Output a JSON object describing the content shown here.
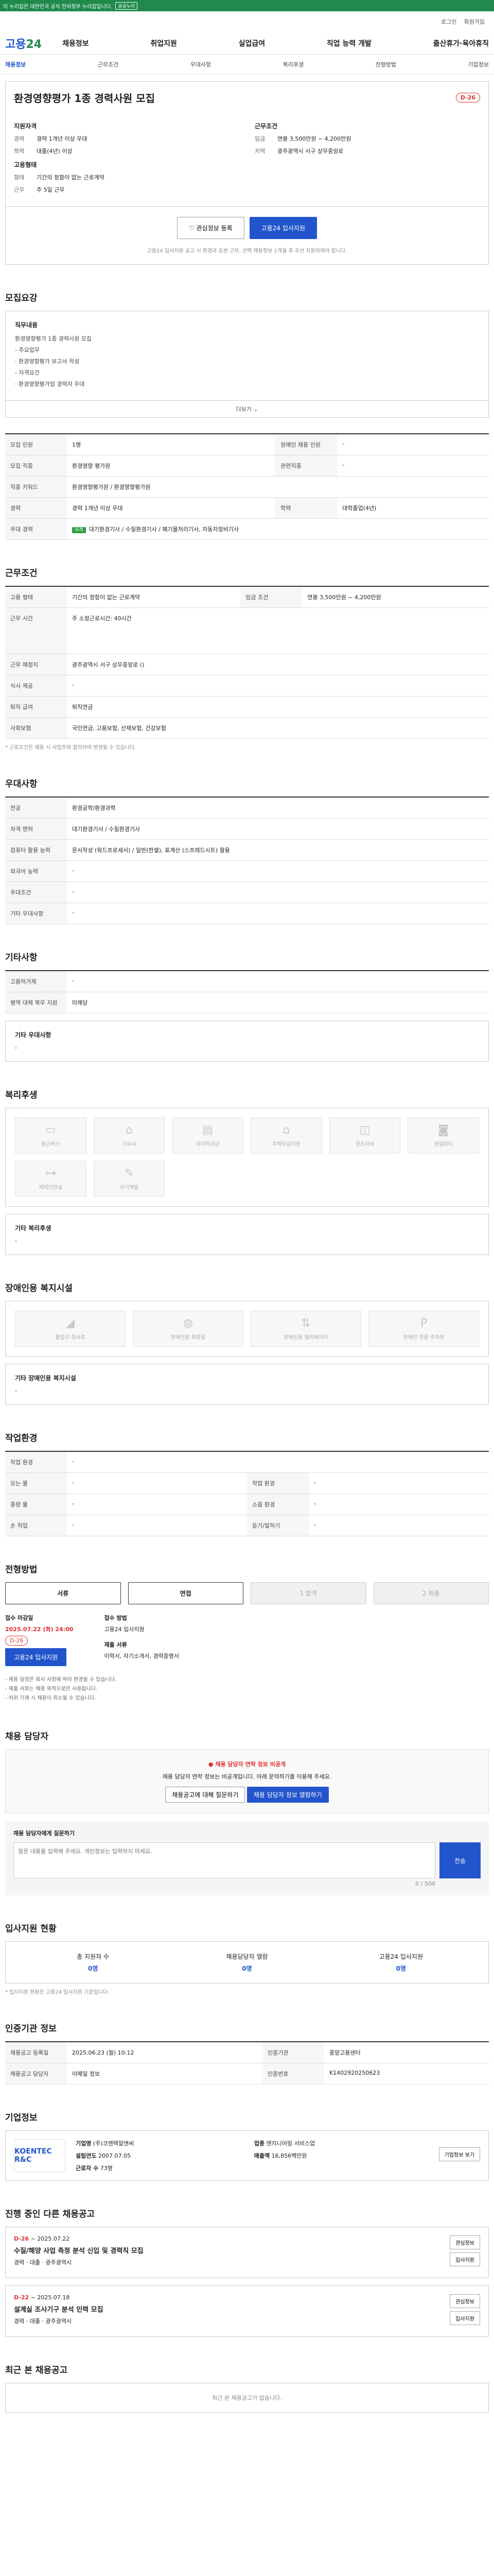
{
  "topbar": {
    "text": "이 누리집은 대한민국 공식 전자정부 누리집입니다.",
    "btn": "공공누리"
  },
  "util": [
    "로그인",
    "회원가입"
  ],
  "logo": {
    "a": "고용",
    "b": "24"
  },
  "gnb": [
    "채용정보",
    "취업지원",
    "실업급여",
    "직업 능력 개발",
    "출산휴가·육아휴직"
  ],
  "tabs": [
    "채용정보",
    "근무조건",
    "우대사항",
    "복리후생",
    "전형방법",
    "기업정보"
  ],
  "job": {
    "title": "환경영향평가 1종 경력사원 모집",
    "dday": "D-26",
    "left_title": "지원자격",
    "left": [
      {
        "k": "경력",
        "v": "경력 1개년 이상 우대"
      },
      {
        "k": "학력",
        "v": "대졸(4년) 이상"
      }
    ],
    "right_title": "근무조건",
    "right": [
      {
        "k": "임금",
        "v": "연봉 3,500만원 ~ 4,200만원"
      },
      {
        "k": "지역",
        "v": "광주광역시 서구 상무중앙로"
      }
    ],
    "left2_title": "고용형태",
    "left2": [
      {
        "k": "형태",
        "v": "기간의 정함이 없는 근로계약"
      },
      {
        "k": "근무",
        "v": "주 5일 근무"
      }
    ],
    "btn_fav": "관심정보 등록",
    "btn_apply": "고용24 입사지원",
    "note": "고용24 입사지원 공고 시 환경과 유분 근무, 선택 채용정보 1개월 후 우선 지원하여야 합니다."
  },
  "recruit": {
    "h": "모집요강",
    "box_title": "직무내용",
    "lines": [
      "환경영향평가 1종 경력사원 모집",
      "- 주요업무",
      "  · 환경영향평가 보고서 작성",
      "- 자격요건",
      "  · 환경영향평가업 경력자 우대"
    ],
    "more": "더보기",
    "rows": [
      {
        "k": "모집 인원",
        "v": "1명",
        "k2": "원예인 채용 인원",
        "v2": "-"
      },
      {
        "k": "모집 직종",
        "v": "환경영향 평가원",
        "k2": "관련직종",
        "v2": "-"
      },
      {
        "k": "직종 키워드",
        "v": "환경영향평가원 / 환경영향평가원"
      },
      {
        "k": "경력",
        "v": "경력 1개년 이상 우대",
        "k2": "학력",
        "v2": "대학졸업(4년)"
      },
      {
        "k": "우대 경력",
        "v": "대기환경기사 / 수질환경기사 / 폐기물처리기사, 자동차정비기사"
      }
    ]
  },
  "cond": {
    "h": "근무조건",
    "rows": [
      {
        "k": "고용 형태",
        "v": "기간의 정함이 없는 근로계약",
        "k2": "임금 조건",
        "v2": "연봉 3,500만원 ~ 4,200만원"
      },
      {
        "k": "근무 시간",
        "v": "주 소정근로시간: 40시간"
      },
      {
        "k": "근무 예정지",
        "v": "광주광역시 서구 상무중앙로 ()"
      },
      {
        "k": "식사 제공",
        "v": "-"
      },
      {
        "k": "퇴직 급여",
        "v": "퇴직연금"
      },
      {
        "k": "사회보험",
        "v": "국민연금, 고용보험, 산재보험, 건강보험"
      }
    ],
    "note": "* 근로조건은 채용 시 사업주와 협의하여 변경될 수 있습니다."
  },
  "pref": {
    "h": "우대사항",
    "rows": [
      {
        "k": "전공",
        "v": "환경공학/환경과학"
      },
      {
        "k": "자격 면허",
        "v": "대기환경기사 / 수질환경기사"
      },
      {
        "k": "컴퓨터 활용 능력",
        "v": "문서작성 (워드프로세서) / 일반(한셀), 표계산 (스프레드시트) 활용"
      },
      {
        "k": "외국어 능력",
        "v": "-"
      },
      {
        "k": "우대조건",
        "v": "-"
      },
      {
        "k": "기타 우대사항",
        "v": "-"
      }
    ]
  },
  "etc": {
    "h": "기타사항",
    "rows": [
      {
        "k": "고용허가제",
        "v": "-"
      },
      {
        "k": "병역 대체 복무 지원",
        "v": "미해당"
      }
    ],
    "box_title": "기타 우대사항",
    "box_value": "-"
  },
  "welfare": {
    "h": "복리후생",
    "cards": [
      "통근버스",
      "기숙사",
      "자녀학자금",
      "주택자금지원",
      "경조사비",
      "생일파티",
      "체력단련실",
      "자기계발"
    ],
    "box_title": "기타 복리후생",
    "box_value": "-"
  },
  "disabled": {
    "h": "장애인용 복지시설",
    "cards": [
      "출입구 경사로",
      "장애인용 화장실",
      "장애인용 엘리베이터",
      "장애인 전용 주차장"
    ],
    "box_title": "기타 장애인용 복지시설",
    "box_value": "-"
  },
  "env": {
    "h": "작업환경",
    "rows": [
      {
        "k": "작업 환경",
        "v": "-"
      },
      {
        "k": "모는 물",
        "v": "-",
        "k2": "작업 환경",
        "v2": "-"
      },
      {
        "k": "중량 물",
        "v": "-",
        "k2": "소음 환경",
        "v2": "-"
      },
      {
        "k": "손 작업",
        "v": "-",
        "k2": "듣기/말하기",
        "v2": "-"
      }
    ]
  },
  "process": {
    "h": "전형방법",
    "steps": [
      "서류",
      "면접",
      "1 합격",
      "2 최종"
    ],
    "apply_label": "접수 마감일",
    "apply_date": "2025.07.22 (화) 24:00",
    "apply_dday": "D-26",
    "apply_btn": "고용24 입사지원",
    "method_label": "접수 방법",
    "method_value": "고용24 입사지원",
    "doc_label": "제출 서류",
    "doc_value": "이력서, 자기소개서, 경력증명서",
    "notes": [
      "- 채용 일정은 회사 사정에 따라 변경될 수 있습니다.",
      "- 제출 서류는 채용 목적으로만 사용됩니다.",
      "- 허위 기재 시 채용이 취소될 수 있습니다."
    ]
  },
  "contact": {
    "h": "채용 담당자",
    "warn_title": "채용 담당자 연락 정보 비공개",
    "warn_text": "채용 담당자 연락 정보는 비공개입니다. 아래 문의하기를 이용해 주세요.",
    "btn1": "채용공고에 대해 질문하기",
    "btn2": "채용 담당자 정보 열람하기",
    "q_title": "채용 담당자에게 질문하기",
    "q_placeholder": "질문 내용을 입력해 주세요. 개인정보는 입력하지 마세요.",
    "q_count": "0 / 500",
    "q_send": "전송"
  },
  "stat": {
    "h": "입사지원 현황",
    "items": [
      {
        "k": "총 지원자 수",
        "v": "0명"
      },
      {
        "k": "채용담당자 열람",
        "v": "0명"
      },
      {
        "k": "고용24 입사지원",
        "v": "0명"
      }
    ],
    "note": "* 입사지원 현황은 고용24 입사지원 기준입니다."
  },
  "auth": {
    "h": "인증기관 정보",
    "rows": [
      {
        "k": "채용공고 등록일",
        "v": "2025.06.23 (월) 10:12",
        "k2": "인증기관",
        "v2": "중앙고용센터"
      },
      {
        "k": "채용공고 담당자",
        "v": "이메일 정보",
        "k2": "인증번호",
        "v2": "K1402920250623"
      }
    ]
  },
  "company": {
    "h": "기업정보",
    "logo": "KOENTEC R&C",
    "rows": [
      {
        "k": "기업명",
        "v": "(주)코엔텍알앤씨"
      },
      {
        "k": "업종",
        "v": "엔지니어링 서비스업"
      },
      {
        "k": "설립연도",
        "v": "2007.07.05"
      },
      {
        "k": "매출액",
        "v": "16,856백만원"
      },
      {
        "k": "근로자 수",
        "v": "73명"
      }
    ],
    "btn": "기업정보 보기"
  },
  "others": {
    "h": "진행 중인 다른 채용공고",
    "jobs": [
      {
        "d": "D-26",
        "date": "~ 2025.07.22",
        "t": "수질/해양 사업 측정 분석 신입 및 경력직 모집",
        "info": "경력 · 대졸 · 광주광역시"
      },
      {
        "d": "D-22",
        "date": "~ 2025.07.18",
        "t": "설계실 조사기구 분석 인력 모집",
        "info": "경력 · 대졸 · 광주광역시"
      }
    ],
    "btn_a": "관심정보",
    "btn_b": "입사지원"
  },
  "recent": {
    "h": "최근 본 채용공고",
    "empty": "최근 본 채용공고가 없습니다."
  }
}
